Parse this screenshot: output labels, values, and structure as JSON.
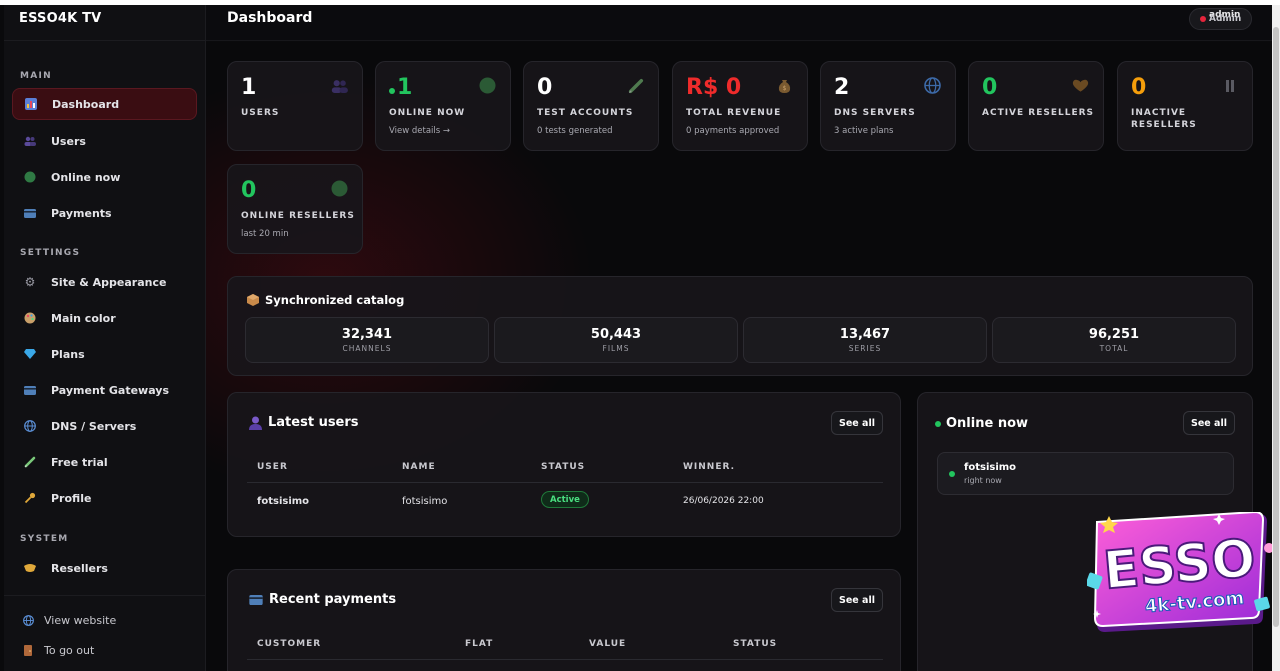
{
  "sidebar": {
    "brand": "ESSO4K TV",
    "sections": {
      "main": "MAIN",
      "settings": "SETTINGS",
      "system": "SYSTEM"
    },
    "items": [
      {
        "label": "Dashboard",
        "icon": "bar-chart-icon"
      },
      {
        "label": "Users",
        "icon": "users-icon"
      },
      {
        "label": "Online now",
        "icon": "green-dot-icon"
      },
      {
        "label": "Payments",
        "icon": "card-icon"
      },
      {
        "label": "Site & Appearance",
        "icon": "gear-icon"
      },
      {
        "label": "Main color",
        "icon": "palette-icon"
      },
      {
        "label": "Plans",
        "icon": "diamond-icon"
      },
      {
        "label": "Payment Gateways",
        "icon": "card-icon"
      },
      {
        "label": "DNS / Servers",
        "icon": "globe-icon"
      },
      {
        "label": "Free trial",
        "icon": "syringe-icon"
      },
      {
        "label": "Profile",
        "icon": "key-icon"
      },
      {
        "label": "Resellers",
        "icon": "handshake-icon"
      }
    ],
    "footer": [
      {
        "label": "View website",
        "icon": "globe-icon"
      },
      {
        "label": "To go out",
        "icon": "door-icon"
      }
    ]
  },
  "header": {
    "title": "Dashboard",
    "admin_label": "Admin",
    "admin_label_overlap": "admin"
  },
  "stats": [
    {
      "value": "1",
      "label": "USERS",
      "sub": "",
      "icon": "users-icon"
    },
    {
      "value": "1",
      "label": "ONLINE NOW",
      "sub": "View details →",
      "icon": "green-circle-icon"
    },
    {
      "value": "0",
      "label": "TEST ACCOUNTS",
      "sub": "0 tests generated",
      "icon": "syringe-icon"
    },
    {
      "value": "R$ 0",
      "label": "TOTAL REVENUE",
      "sub": "0 payments approved",
      "icon": "money-bag-icon"
    },
    {
      "value": "2",
      "label": "DNS SERVERS",
      "sub": "3 active plans",
      "icon": "globe-icon"
    },
    {
      "value": "0",
      "label": "ACTIVE RESELLERS",
      "sub": "",
      "icon": "heart-icon"
    },
    {
      "value": "0",
      "label": "INACTIVE RESELLERS",
      "sub": "",
      "icon": "pause-icon"
    },
    {
      "value": "0",
      "label": "ONLINE RESELLERS",
      "sub": "last 20 min",
      "icon": "green-circle-icon"
    }
  ],
  "catalog": {
    "title": "Synchronized catalog",
    "items": [
      {
        "value": "32,341",
        "label": "CHANNELS"
      },
      {
        "value": "50,443",
        "label": "FILMS"
      },
      {
        "value": "13,467",
        "label": "SERIES"
      },
      {
        "value": "96,251",
        "label": "TOTAL"
      }
    ]
  },
  "latest_users": {
    "title": "Latest users",
    "see_all": "See all",
    "columns": [
      "USER",
      "NAME",
      "STATUS",
      "WINNER."
    ],
    "rows": [
      {
        "user": "fotsisimo",
        "name": "fotsisimo",
        "status": "Active",
        "winner": "26/06/2026 22:00"
      }
    ]
  },
  "recent_payments": {
    "title": "Recent payments",
    "see_all": "See all",
    "columns": [
      "CUSTOMER",
      "FLAT",
      "VALUE",
      "STATUS"
    ]
  },
  "online_now": {
    "title": "Online now",
    "see_all": "See all",
    "entries": [
      {
        "name": "fotsisimo",
        "time": "right now"
      }
    ]
  },
  "logo": {
    "line1": "ESSO",
    "line2": "4k-tv.com"
  },
  "colors": {
    "accent_red": "#ef2b2b",
    "accent_green": "#22c55e",
    "accent_orange": "#f59e0b",
    "logo_pink": "#e83fc8"
  }
}
